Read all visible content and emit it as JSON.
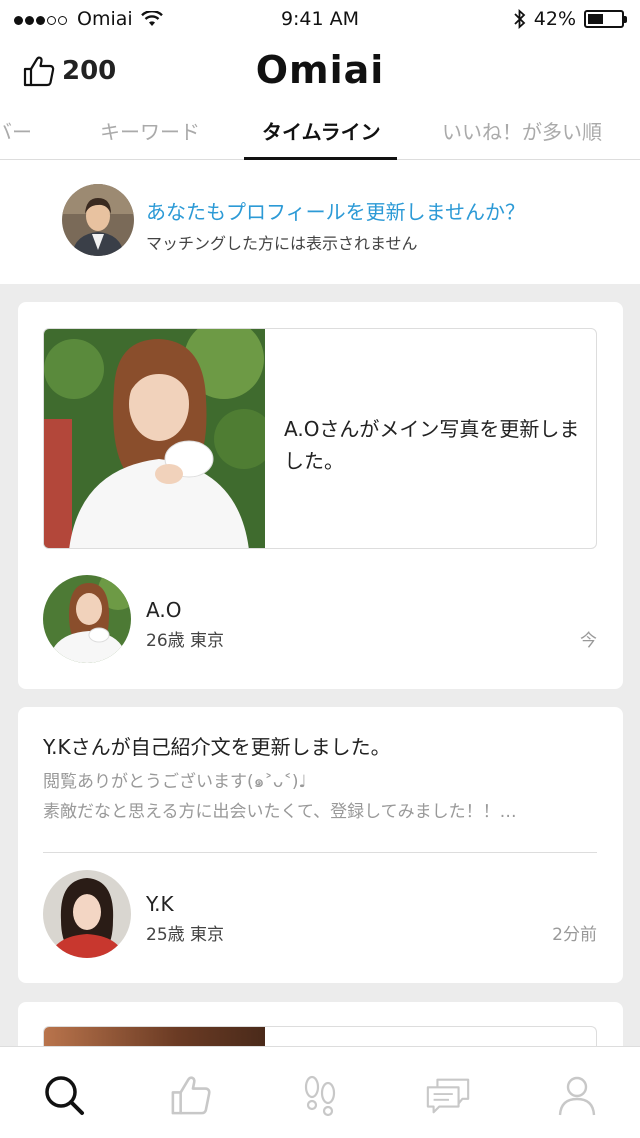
{
  "status_bar": {
    "carrier": "Omiai",
    "time": "9:41 AM",
    "battery": "42%",
    "signal_bars_filled": 3,
    "signal_bars_total": 5,
    "battery_level": 0.42
  },
  "header": {
    "like_count": "200",
    "logo": "Omiai"
  },
  "tabs": [
    {
      "label": "バー"
    },
    {
      "label": "キーワード"
    },
    {
      "label": "タイムライン",
      "active": true
    },
    {
      "label": "いいね！が多い順"
    }
  ],
  "banner": {
    "title": "あなたもプロフィールを更新しませんか？",
    "subtitle": "マッチングした方には表示されません"
  },
  "timeline": [
    {
      "post_text": "A.Oさんがメイン写真を更新しました。",
      "user_name": "A.O",
      "user_meta": "26歳 東京",
      "time": "今"
    },
    {
      "title": "Y.Kさんが自己紹介文を更新しました。",
      "body_line1": "閲覧ありがとうございます(๑˃ᴗ˂)♩",
      "body_line2": "素敵だなと思える方に出会いたくて、登録してみました！！…",
      "user_name": "Y.K",
      "user_meta": "25歳 東京",
      "time": "2分前"
    }
  ],
  "bottom_nav": [
    {
      "icon": "search-icon",
      "active": true
    },
    {
      "icon": "thumbs-up-icon"
    },
    {
      "icon": "footprints-icon"
    },
    {
      "icon": "messages-icon"
    },
    {
      "icon": "profile-icon"
    }
  ],
  "colors": {
    "accent_blue": "#2c9ad6",
    "background": "#ececec",
    "inactive_icon": "#c8c8c8"
  }
}
